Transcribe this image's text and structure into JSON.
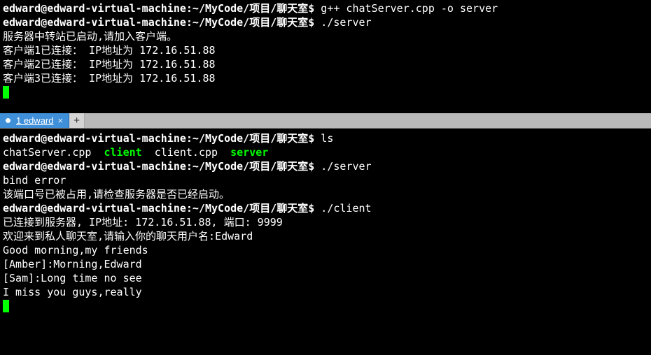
{
  "top": {
    "lines": [
      {
        "prompt": "edward@edward-virtual-machine:~/MyCode/项目/聊天室$",
        "cmd": " g++ chatServer.cpp -o server"
      },
      {
        "prompt": "edward@edward-virtual-machine:~/MyCode/项目/聊天室$",
        "cmd": " ./server"
      },
      {
        "text": "服务器中转站已启动,请加入客户端。"
      },
      {
        "text": "客户端1已连接： IP地址为 172.16.51.88"
      },
      {
        "text": "客户端2已连接： IP地址为 172.16.51.88"
      },
      {
        "text": "客户端3已连接： IP地址为 172.16.51.88"
      }
    ]
  },
  "tab": {
    "label": "1 edward"
  },
  "bottom": {
    "lines": [
      {
        "prompt": "edward@edward-virtual-machine:~/MyCode/项目/聊天室$",
        "cmd": " ls"
      },
      {
        "ls": true,
        "parts": [
          {
            "text": "chatServer.cpp  ",
            "cls": ""
          },
          {
            "text": "client",
            "cls": "green-bold"
          },
          {
            "text": "  client.cpp  ",
            "cls": ""
          },
          {
            "text": "server",
            "cls": "green-bold"
          }
        ]
      },
      {
        "prompt": "edward@edward-virtual-machine:~/MyCode/项目/聊天室$",
        "cmd": " ./server"
      },
      {
        "text": "bind error"
      },
      {
        "text": "该端口号已被占用,请检查服务器是否已经启动。"
      },
      {
        "prompt": "edward@edward-virtual-machine:~/MyCode/项目/聊天室$",
        "cmd": " ./client"
      },
      {
        "text": "已连接到服务器, IP地址: 172.16.51.88, 端口: 9999"
      },
      {
        "text": "欢迎来到私人聊天室,请输入你的聊天用户名:Edward"
      },
      {
        "text": "Good morning,my friends"
      },
      {
        "text": "[Amber]:Morning,Edward"
      },
      {
        "text": "[Sam]:Long time no see"
      },
      {
        "text": "I miss you guys,really"
      }
    ]
  }
}
